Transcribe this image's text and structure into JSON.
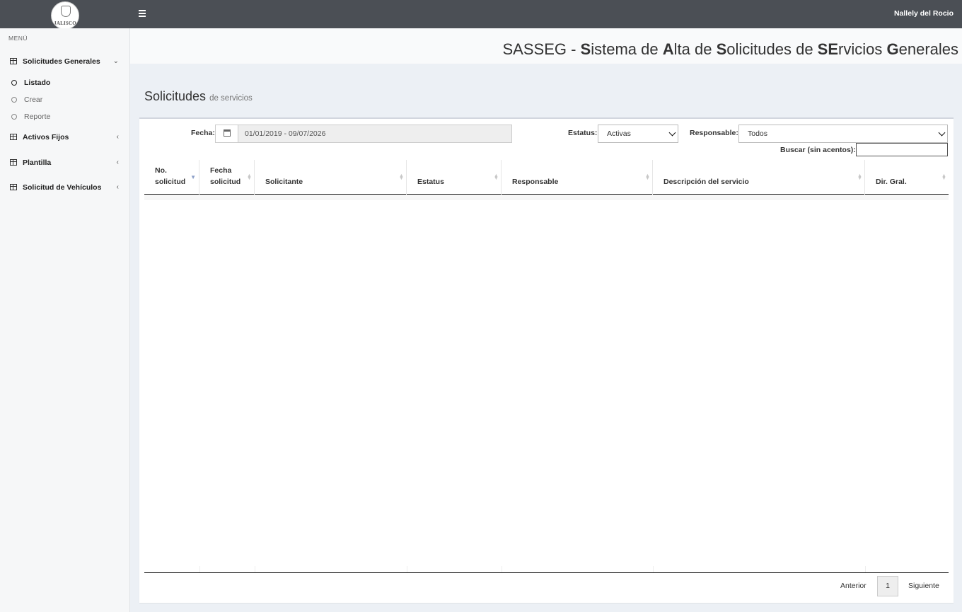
{
  "header": {
    "logo_text": "JALISCO",
    "username": "Nallely del Rocio"
  },
  "sidebar": {
    "menu_label": "MENÚ",
    "items": [
      {
        "label": "Solicitudes Generales",
        "chevron": "⌄"
      },
      {
        "label": "Activos Fijos",
        "chevron": "‹"
      },
      {
        "label": "Plantilla",
        "chevron": "‹"
      },
      {
        "label": "Solicitud de Vehículos",
        "chevron": "‹"
      }
    ],
    "subitems": [
      {
        "label": "Listado",
        "active": true
      },
      {
        "label": "Crear",
        "active": false
      },
      {
        "label": "Reporte",
        "active": false
      }
    ]
  },
  "system_title": {
    "parts": [
      "SASSEG - ",
      "S",
      "istema de ",
      "A",
      "lta de ",
      "S",
      "olicitudes de ",
      "SE",
      "rvicios ",
      "G",
      "enerales"
    ]
  },
  "page": {
    "title": "Solicitudes",
    "subtitle": "de servicios"
  },
  "filters": {
    "fecha_label": "Fecha:",
    "fecha_value": "01/01/2019 - 09/07/2026",
    "estatus_label": "Estatus:",
    "estatus_value": "Activas",
    "responsable_label": "Responsable:",
    "responsable_value": "Todos",
    "buscar_label": "Buscar (sin acentos):",
    "buscar_value": ""
  },
  "table": {
    "columns": [
      {
        "line1": "No.",
        "line2": "solicitud",
        "sort": "▲▼"
      },
      {
        "line1": "Fecha",
        "line2": "solicitud",
        "sort": "▲▼"
      },
      {
        "line1": "",
        "line2": "Solicitante",
        "sort": "▲▼"
      },
      {
        "line1": "",
        "line2": "Estatus",
        "sort": "▲▼"
      },
      {
        "line1": "",
        "line2": "Responsable",
        "sort": "▲▼"
      },
      {
        "line1": "",
        "line2": "Descripción del servicio",
        "sort": "▲▼"
      },
      {
        "line1": "",
        "line2": "Dir. Gral.",
        "sort": "▲▼"
      }
    ],
    "active_sort_column": 0,
    "active_sort_glyph": "▼"
  },
  "pagination": {
    "prev": "Anterior",
    "current": "1",
    "next": "Siguiente"
  },
  "colors": {
    "topbar": "#4b4f55",
    "sidebar": "#f6f7f8",
    "content_bg": "#ecf0f5"
  }
}
